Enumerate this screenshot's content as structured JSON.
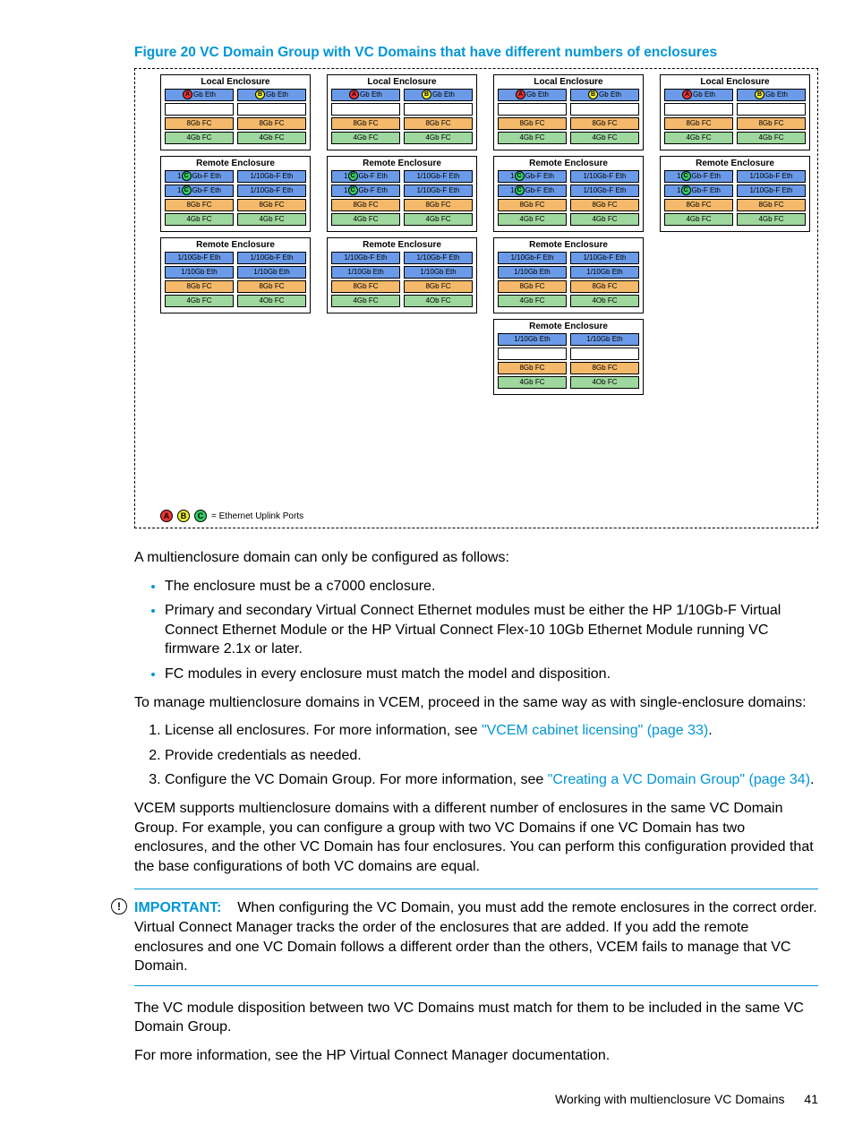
{
  "figure": {
    "caption": "Figure 20 VC Domain Group with VC Domains that have different numbers of enclosures",
    "legend": "= Ethernet Uplink Ports",
    "dots": [
      "A",
      "B",
      "C"
    ],
    "columns": [
      [
        {
          "title": "Local Enclosure",
          "rows": [
            [
              "A|Gb Eth|blue",
              "B|Gb Eth|blue"
            ],
            [
              "|empty",
              "|empty"
            ],
            [
              "8Gb FC|orange",
              "8Gb FC|orange"
            ],
            [
              "4Gb FC|green",
              "4Gb FC|green"
            ]
          ]
        },
        {
          "title": "Remote Enclosure",
          "rows": [
            [
              "1C|Gb-F Eth|blue",
              "1/10Gb-F Eth|blue"
            ],
            [
              "1C|Gb-F Eth|blue",
              "1/10Gb-F Eth|blue"
            ],
            [
              "8Gb FC|orange",
              "8Gb FC|orange"
            ],
            [
              "4Gb FC|green",
              "4Gb FC|green"
            ]
          ]
        },
        {
          "title": "Remote Enclosure",
          "rows": [
            [
              "1/10Gb-F Eth|blue",
              "1/10Gb-F Eth|blue"
            ],
            [
              "1/10Gb Eth|blue",
              "1/10Gb Eth|blue"
            ],
            [
              "8Gb FC|orange",
              "8Gb FC|orange"
            ],
            [
              "4Gb FC|green",
              "4Ob FC|green"
            ]
          ]
        }
      ],
      [
        {
          "title": "Local Enclosure",
          "rows": [
            [
              "A|Gb Eth|blue",
              "B|Gb Eth|blue"
            ],
            [
              "|empty",
              "|empty"
            ],
            [
              "8Gb FC|orange",
              "8Gb FC|orange"
            ],
            [
              "4Gb FC|green",
              "4Gb FC|green"
            ]
          ]
        },
        {
          "title": "Remote Enclosure",
          "rows": [
            [
              "1C|Gb-F Eth|blue",
              "1/10Gb-F Eth|blue"
            ],
            [
              "1C|Gb-F Eth|blue",
              "1/10Gb-F Eth|blue"
            ],
            [
              "8Gb FC|orange",
              "8Gb FC|orange"
            ],
            [
              "4Gb FC|green",
              "4Gb FC|green"
            ]
          ]
        },
        {
          "title": "Remote Enclosure",
          "rows": [
            [
              "1/10Gb-F Eth|blue",
              "1/10Gb-F Eth|blue"
            ],
            [
              "1/10Gb Eth|blue",
              "1/10Gb Eth|blue"
            ],
            [
              "8Gb FC|orange",
              "8Gb FC|orange"
            ],
            [
              "4Gb FC|green",
              "4Ob FC|green"
            ]
          ]
        }
      ],
      [
        {
          "title": "Local Enclosure",
          "rows": [
            [
              "A|Gb Eth|blue",
              "B|Gb Eth|blue"
            ],
            [
              "|empty",
              "|empty"
            ],
            [
              "8Gb FC|orange",
              "8Gb FC|orange"
            ],
            [
              "4Gb FC|green",
              "4Gb FC|green"
            ]
          ]
        },
        {
          "title": "Remote Enclosure",
          "rows": [
            [
              "1C|Gb-F Eth|blue",
              "1/10Gb-F Eth|blue"
            ],
            [
              "1C|Gb-F Eth|blue",
              "1/10Gb-F Eth|blue"
            ],
            [
              "8Gb FC|orange",
              "8Gb FC|orange"
            ],
            [
              "4Gb FC|green",
              "4Gb FC|green"
            ]
          ]
        },
        {
          "title": "Remote Enclosure",
          "rows": [
            [
              "1/10Gb-F Eth|blue",
              "1/10Gb-F Eth|blue"
            ],
            [
              "1/10Gb Eth|blue",
              "1/10Gb Eth|blue"
            ],
            [
              "8Gb FC|orange",
              "8Gb FC|orange"
            ],
            [
              "4Gb FC|green",
              "4Ob FC|green"
            ]
          ]
        },
        {
          "title": "Remote Enclosure",
          "rows": [
            [
              "1/10Gb Eth|blue",
              "1/10Gb Eth|blue"
            ],
            [
              "|empty",
              "|empty"
            ],
            [
              "8Gb FC|orange",
              "8Gb FC|orange"
            ],
            [
              "4Gb FC|green",
              "4Ob FC|green"
            ]
          ]
        }
      ],
      [
        {
          "title": "Local Enclosure",
          "rows": [
            [
              "A|Gb Eth|blue",
              "B|Gb Eth|blue"
            ],
            [
              "|empty",
              "|empty"
            ],
            [
              "8Gb FC|orange",
              "8Gb FC|orange"
            ],
            [
              "4Gb FC|green",
              "4Gb FC|green"
            ]
          ]
        },
        {
          "title": "Remote Enclosure",
          "rows": [
            [
              "1C|Gb-F Eth|blue",
              "1/10Gb-F Eth|blue"
            ],
            [
              "1C|Gb-F Eth|blue",
              "1/10Gb-F Eth|blue"
            ],
            [
              "8Gb FC|orange",
              "8Gb FC|orange"
            ],
            [
              "4Gb FC|green",
              "4Gb FC|green"
            ]
          ]
        }
      ]
    ]
  },
  "para1": "A multienclosure domain can only be configured as follows:",
  "bullets": [
    "The enclosure must be a c7000 enclosure.",
    "Primary and secondary Virtual Connect Ethernet modules must be either the HP 1/10Gb-F Virtual Connect Ethernet Module or the HP Virtual Connect Flex-10 10Gb Ethernet Module running VC firmware 2.1x or later.",
    "FC modules in every enclosure must match the model and disposition."
  ],
  "para2": "To manage multienclosure domains in VCEM, proceed in the same way as with single-enclosure domains:",
  "steps": {
    "s1a": "License all enclosures. For more information, see ",
    "s1link": "\"VCEM cabinet licensing\" (page 33)",
    "s1b": ".",
    "s2": "Provide credentials as needed.",
    "s3a": "Configure the VC Domain Group. For more information, see ",
    "s3link": "\"Creating a VC Domain Group\" (page 34)",
    "s3b": "."
  },
  "para3": "VCEM supports multienclosure domains with a different number of enclosures in the same VC Domain Group. For example, you can configure a group with two VC Domains if one VC Domain has two enclosures, and the other VC Domain has four enclosures. You can perform this configuration provided that the base configurations of both VC domains are equal.",
  "important": {
    "label": "IMPORTANT:",
    "text": "When configuring the VC Domain, you must add the remote enclosures in the correct order. Virtual Connect Manager tracks the order of the enclosures that are added. If you add the remote enclosures and one VC Domain follows a different order than the others, VCEM fails to manage that VC Domain."
  },
  "para4": "The VC module disposition between two VC Domains must match for them to be included in the same VC Domain Group.",
  "para5": "For more information, see the HP Virtual Connect Manager documentation.",
  "footer": {
    "text": "Working with multienclosure VC Domains",
    "page": "41"
  }
}
